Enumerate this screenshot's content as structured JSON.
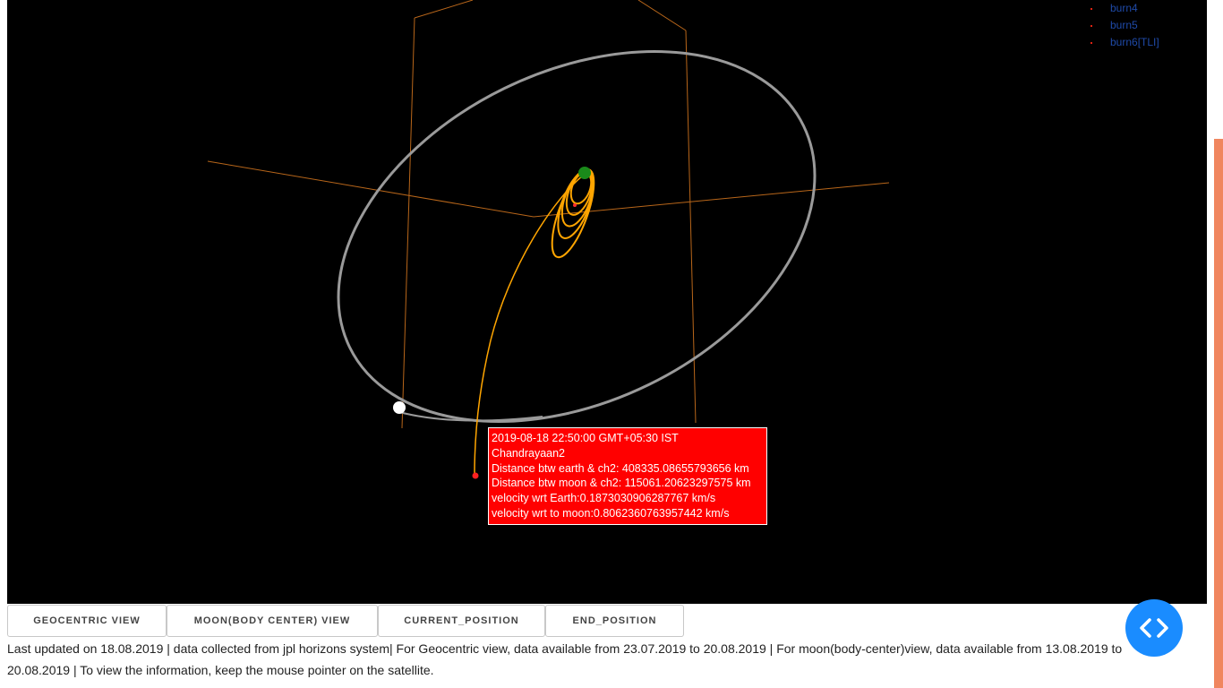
{
  "legend": {
    "items": [
      {
        "label": "burn4"
      },
      {
        "label": "burn5"
      },
      {
        "label": "burn6[TLI]"
      }
    ]
  },
  "tooltip": {
    "lines": [
      "2019-08-18 22:50:00 GMT+05:30 IST",
      "Chandrayaan2",
      "Distance btw earth & ch2: 408335.08655793656 km",
      "Distance btw moon & ch2: 115061.20623297575 km",
      "velocity wrt Earth:0.1873030906287767 km/s",
      "velocity wrt to moon:0.8062360763957442 km/s"
    ]
  },
  "buttons": {
    "geocentric": "GEOCENTRIC VIEW",
    "moon_view": "MOON(BODY CENTER) VIEW",
    "current_position": "CURRENT_POSITION",
    "end_position": "END_POSITION"
  },
  "info_text": "Last updated on 18.08.2019 | data collected from jpl horizons system| For Geocentric view, data available from 23.07.2019 to 20.08.2019 | For moon(body-center)view, data available from 13.08.2019 to 20.08.2019 | To view the information, keep the mouse pointer on the satellite.",
  "colors": {
    "background": "#000000",
    "axes": "#b8661a",
    "moon_orbit": "#9a9a9a",
    "spacecraft_orbit": "#ffa500",
    "earth": "#1a8a1a",
    "moon": "#ffffff",
    "tooltip_bg": "#ff0000",
    "scroll_thumb": "#f0865f",
    "fab": "#1a8cff"
  },
  "icons": {
    "nav_fab": "code-brackets-icon"
  }
}
